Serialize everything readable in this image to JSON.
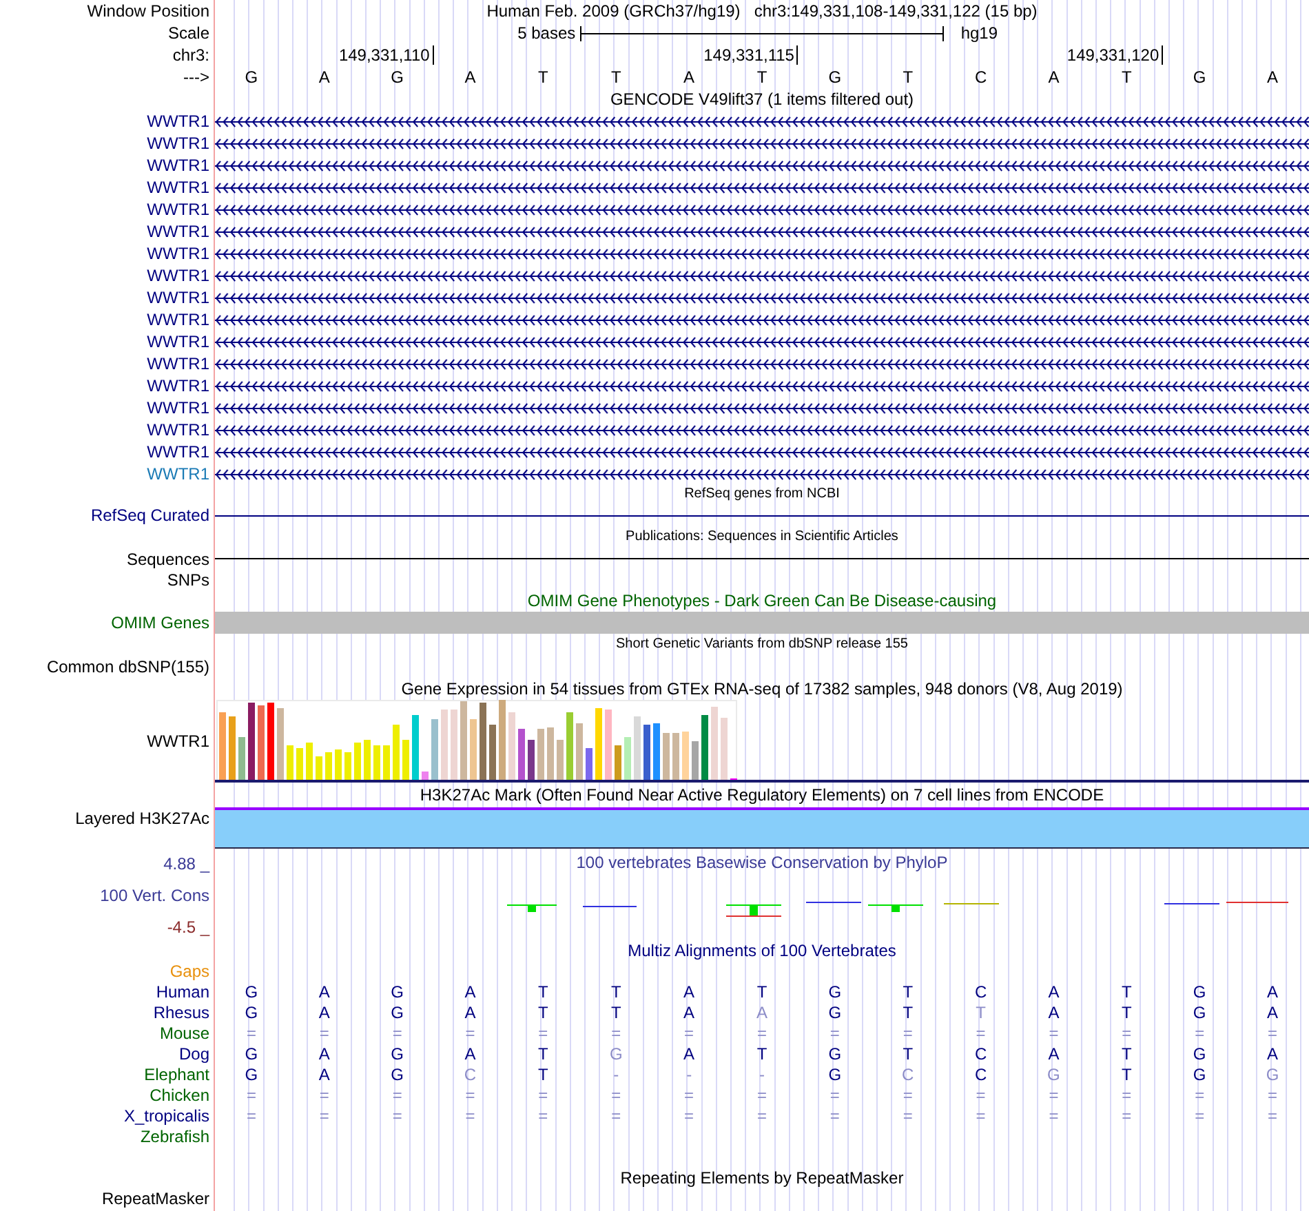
{
  "position": {
    "label": "Window Position",
    "assembly": "Human Feb. 2009 (GRCh37/hg19)",
    "range": "chr3:149,331,108-149,331,122 (15 bp)"
  },
  "scale": {
    "label": "Scale",
    "span": "5 bases",
    "genome": "hg19"
  },
  "ruler": {
    "label": "chr3:",
    "ticks": [
      "149,331,110",
      "149,331,115",
      "149,331,120"
    ]
  },
  "sequence": {
    "label": "--->",
    "bases": [
      "G",
      "A",
      "G",
      "A",
      "T",
      "T",
      "A",
      "T",
      "G",
      "T",
      "C",
      "A",
      "T",
      "G",
      "A"
    ]
  },
  "tracks": [
    {
      "kind": "genes",
      "title": "GENCODE V49lift37 (1 items filtered out)",
      "items": [
        {
          "label": "WWTR1",
          "color": "#000080"
        },
        {
          "label": "WWTR1",
          "color": "#000080"
        },
        {
          "label": "WWTR1",
          "color": "#000080"
        },
        {
          "label": "WWTR1",
          "color": "#000080"
        },
        {
          "label": "WWTR1",
          "color": "#000080"
        },
        {
          "label": "WWTR1",
          "color": "#000080"
        },
        {
          "label": "WWTR1",
          "color": "#000080"
        },
        {
          "label": "WWTR1",
          "color": "#000080"
        },
        {
          "label": "WWTR1",
          "color": "#000080"
        },
        {
          "label": "WWTR1",
          "color": "#000080"
        },
        {
          "label": "WWTR1",
          "color": "#000080"
        },
        {
          "label": "WWTR1",
          "color": "#000080"
        },
        {
          "label": "WWTR1",
          "color": "#000080"
        },
        {
          "label": "WWTR1",
          "color": "#000080"
        },
        {
          "label": "WWTR1",
          "color": "#000080"
        },
        {
          "label": "WWTR1",
          "color": "#000080"
        },
        {
          "label": "WWTR1",
          "color": "#1a7ab5"
        }
      ]
    },
    {
      "kind": "line",
      "title": "RefSeq genes from NCBI",
      "labels": [
        "RefSeq Curated"
      ],
      "color": "#000080"
    },
    {
      "kind": "line",
      "title": "Publications: Sequences in Scientific Articles",
      "labels": [
        "Sequences",
        "SNPs"
      ],
      "color": "#000000"
    },
    {
      "kind": "block",
      "title": "OMIM Gene Phenotypes - Dark Green Can Be Disease-causing",
      "labels": [
        "OMIM Genes"
      ],
      "color": "#006400"
    },
    {
      "kind": "empty",
      "title": "Short Genetic Variants from dbSNP release 155",
      "labels": [
        "Common dbSNP(155)"
      ],
      "color": "#000000"
    },
    {
      "kind": "expression",
      "title": "Gene Expression in 54 tissues from GTEx RNA-seq of 17382 samples, 948 donors (V8, Aug 2019)",
      "labels": [
        "WWTR1"
      ],
      "color": "#000000"
    },
    {
      "kind": "layered",
      "title": "H3K27Ac Mark (Often Found Near Active Regulatory Elements) on 7 cell lines from ENCODE",
      "labels": [
        "Layered H3K27Ac"
      ],
      "color": "#000000"
    },
    {
      "kind": "wiggle",
      "title": "100 vertebrates Basewise Conservation by PhyloP",
      "labels": [
        "100 Vert. Cons"
      ],
      "max": "4.88 _",
      "min": "-4.5 _",
      "color": "#3a3a96"
    },
    {
      "kind": "alignment",
      "title": "Multiz Alignments of 100 Vertebrates",
      "labels": [
        "Gaps"
      ],
      "color": "#000080",
      "species": [
        {
          "name": "Human",
          "color": "#000080",
          "bases": [
            {
              "b": "G",
              "dim": false
            },
            {
              "b": "A",
              "dim": false
            },
            {
              "b": "G",
              "dim": false
            },
            {
              "b": "A",
              "dim": false
            },
            {
              "b": "T",
              "dim": false
            },
            {
              "b": "T",
              "dim": false
            },
            {
              "b": "A",
              "dim": false
            },
            {
              "b": "T",
              "dim": false
            },
            {
              "b": "G",
              "dim": false
            },
            {
              "b": "T",
              "dim": false
            },
            {
              "b": "C",
              "dim": false
            },
            {
              "b": "A",
              "dim": false
            },
            {
              "b": "T",
              "dim": false
            },
            {
              "b": "G",
              "dim": false
            },
            {
              "b": "A",
              "dim": false
            }
          ]
        },
        {
          "name": "Rhesus",
          "color": "#000080",
          "bases": [
            {
              "b": "G",
              "dim": false
            },
            {
              "b": "A",
              "dim": false
            },
            {
              "b": "G",
              "dim": false
            },
            {
              "b": "A",
              "dim": false
            },
            {
              "b": "T",
              "dim": false
            },
            {
              "b": "T",
              "dim": false
            },
            {
              "b": "A",
              "dim": false
            },
            {
              "b": "A",
              "dim": true
            },
            {
              "b": "G",
              "dim": false
            },
            {
              "b": "T",
              "dim": false
            },
            {
              "b": "T",
              "dim": true
            },
            {
              "b": "A",
              "dim": false
            },
            {
              "b": "T",
              "dim": false
            },
            {
              "b": "G",
              "dim": false
            },
            {
              "b": "A",
              "dim": false
            }
          ]
        },
        {
          "name": "Mouse",
          "color": "#006400",
          "bases": [
            {
              "b": "=",
              "dim": true
            },
            {
              "b": "=",
              "dim": true
            },
            {
              "b": "=",
              "dim": true
            },
            {
              "b": "=",
              "dim": true
            },
            {
              "b": "=",
              "dim": true
            },
            {
              "b": "=",
              "dim": true
            },
            {
              "b": "=",
              "dim": true
            },
            {
              "b": "=",
              "dim": true
            },
            {
              "b": "=",
              "dim": true
            },
            {
              "b": "=",
              "dim": true
            },
            {
              "b": "=",
              "dim": true
            },
            {
              "b": "=",
              "dim": true
            },
            {
              "b": "=",
              "dim": true
            },
            {
              "b": "=",
              "dim": true
            },
            {
              "b": "=",
              "dim": true
            }
          ]
        },
        {
          "name": "Dog",
          "color": "#000080",
          "bases": [
            {
              "b": "G",
              "dim": false
            },
            {
              "b": "A",
              "dim": false
            },
            {
              "b": "G",
              "dim": false
            },
            {
              "b": "A",
              "dim": false
            },
            {
              "b": "T",
              "dim": false
            },
            {
              "b": "G",
              "dim": true
            },
            {
              "b": "A",
              "dim": false
            },
            {
              "b": "T",
              "dim": false
            },
            {
              "b": "G",
              "dim": false
            },
            {
              "b": "T",
              "dim": false
            },
            {
              "b": "C",
              "dim": false
            },
            {
              "b": "A",
              "dim": false
            },
            {
              "b": "T",
              "dim": false
            },
            {
              "b": "G",
              "dim": false
            },
            {
              "b": "A",
              "dim": false
            }
          ]
        },
        {
          "name": "Elephant",
          "color": "#006400",
          "bases": [
            {
              "b": "G",
              "dim": false
            },
            {
              "b": "A",
              "dim": false
            },
            {
              "b": "G",
              "dim": false
            },
            {
              "b": "C",
              "dim": true
            },
            {
              "b": "T",
              "dim": false
            },
            {
              "b": "-",
              "dim": true
            },
            {
              "b": "-",
              "dim": true
            },
            {
              "b": "-",
              "dim": true
            },
            {
              "b": "G",
              "dim": false
            },
            {
              "b": "C",
              "dim": true
            },
            {
              "b": "C",
              "dim": false
            },
            {
              "b": "G",
              "dim": true
            },
            {
              "b": "T",
              "dim": false
            },
            {
              "b": "G",
              "dim": false
            },
            {
              "b": "G",
              "dim": true
            }
          ]
        },
        {
          "name": "Chicken",
          "color": "#006400",
          "bases": [
            {
              "b": "=",
              "dim": true
            },
            {
              "b": "=",
              "dim": true
            },
            {
              "b": "=",
              "dim": true
            },
            {
              "b": "=",
              "dim": true
            },
            {
              "b": "=",
              "dim": true
            },
            {
              "b": "=",
              "dim": true
            },
            {
              "b": "=",
              "dim": true
            },
            {
              "b": "=",
              "dim": true
            },
            {
              "b": "=",
              "dim": true
            },
            {
              "b": "=",
              "dim": true
            },
            {
              "b": "=",
              "dim": true
            },
            {
              "b": "=",
              "dim": true
            },
            {
              "b": "=",
              "dim": true
            },
            {
              "b": "=",
              "dim": true
            },
            {
              "b": "=",
              "dim": true
            }
          ]
        },
        {
          "name": "X_tropicalis",
          "color": "#000080",
          "bases": [
            {
              "b": "=",
              "dim": true
            },
            {
              "b": "=",
              "dim": true
            },
            {
              "b": "=",
              "dim": true
            },
            {
              "b": "=",
              "dim": true
            },
            {
              "b": "=",
              "dim": true
            },
            {
              "b": "=",
              "dim": true
            },
            {
              "b": "=",
              "dim": true
            },
            {
              "b": "=",
              "dim": true
            },
            {
              "b": "=",
              "dim": true
            },
            {
              "b": "=",
              "dim": true
            },
            {
              "b": "=",
              "dim": true
            },
            {
              "b": "=",
              "dim": true
            },
            {
              "b": "=",
              "dim": true
            },
            {
              "b": "=",
              "dim": true
            },
            {
              "b": "=",
              "dim": true
            }
          ]
        },
        {
          "name": "Zebrafish",
          "color": "#006400"
        }
      ]
    },
    {
      "kind": "repeat",
      "title": "Repeating Elements by RepeatMasker",
      "labels": [
        "RepeatMasker"
      ],
      "color": "#000000"
    }
  ]
}
